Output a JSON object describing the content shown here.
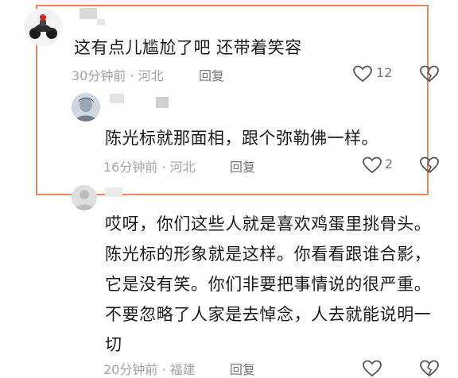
{
  "comments": [
    {
      "text": "这有点儿尴尬了吧 还带着笑容",
      "meta": "30分钟前 · 河北",
      "reply_label": "回复",
      "likes": "12"
    },
    {
      "text": "陈光标就那面相，跟个弥勒佛一样。",
      "meta": "16分钟前 · 河北",
      "reply_label": "回复",
      "likes": "2"
    },
    {
      "lines": [
        "哎呀，你们这些人就是喜欢鸡蛋里挑骨头。",
        "陈光标的形象就是这样。你看看跟谁合影，",
        "它是没有笑。你们非要把事情说的很严重。",
        "不要忽略了人家是去悼念，人去就能说明一",
        "切"
      ],
      "meta": "20分钟前 · 福建",
      "reply_label": "回复"
    }
  ],
  "colors": {
    "highlight_border": "#f0855a",
    "meta_text": "#a3a3a3"
  }
}
